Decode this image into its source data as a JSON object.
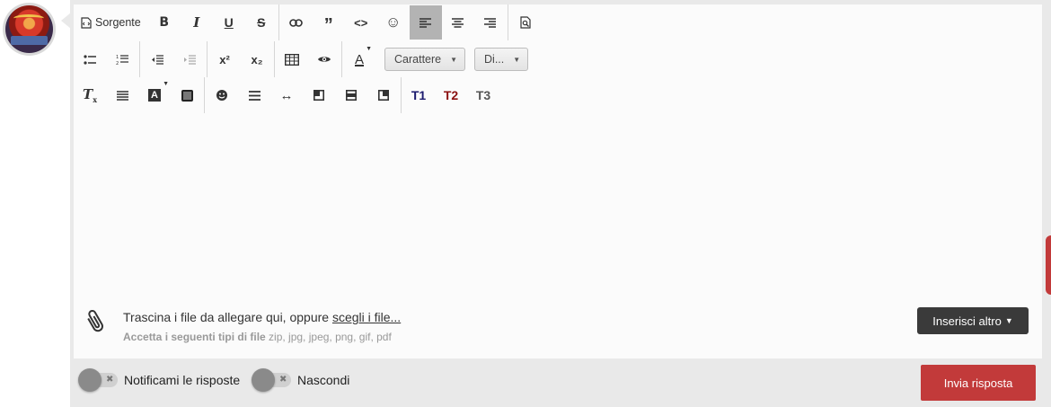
{
  "toolbar": {
    "source_label": "Sorgente",
    "bold": "B",
    "italic": "I",
    "underline": "U",
    "strike": "S",
    "link": "🔗",
    "quote": "”",
    "code": "<>",
    "emoji": "☺",
    "align_left": "≡",
    "align_center": "≡",
    "align_right": "≡",
    "preview": "⌕",
    "bullets": "•≡",
    "numbers": "1≡",
    "outdent": "⇤",
    "indent": "⇥",
    "superscript": "x²",
    "subscript": "x₂",
    "table": "▦",
    "eye": "👁",
    "font_color": "A",
    "font_combo": "Carattere",
    "size_combo": "Di...",
    "clear_format": "Tx",
    "justify": "≣",
    "bg_color": "A",
    "box": "■",
    "spoiler": "☻",
    "lines": "☰",
    "arrows": "↔",
    "frame_tl": "◰",
    "frame_mid": "▬",
    "frame_tr": "◳",
    "t1": "T1",
    "t2": "T2",
    "t3": "T3"
  },
  "attach": {
    "text": "Trascina i file da allegare qui, oppure ",
    "link": "scegli i file...",
    "types_label": "Accetta i seguenti tipi di file",
    "types": " zip, jpg, jpeg, png, gif, pdf"
  },
  "buttons": {
    "more": "Inserisci altro",
    "send": "Invia risposta"
  },
  "toggles": {
    "notify": "Notificami le risposte",
    "hide": "Nascondi"
  },
  "colors": {
    "accent": "#c23a3a",
    "dark_button": "#3a3a3a",
    "t1": "#1b1a6e",
    "t2": "#8b1010",
    "t3": "#555555"
  }
}
